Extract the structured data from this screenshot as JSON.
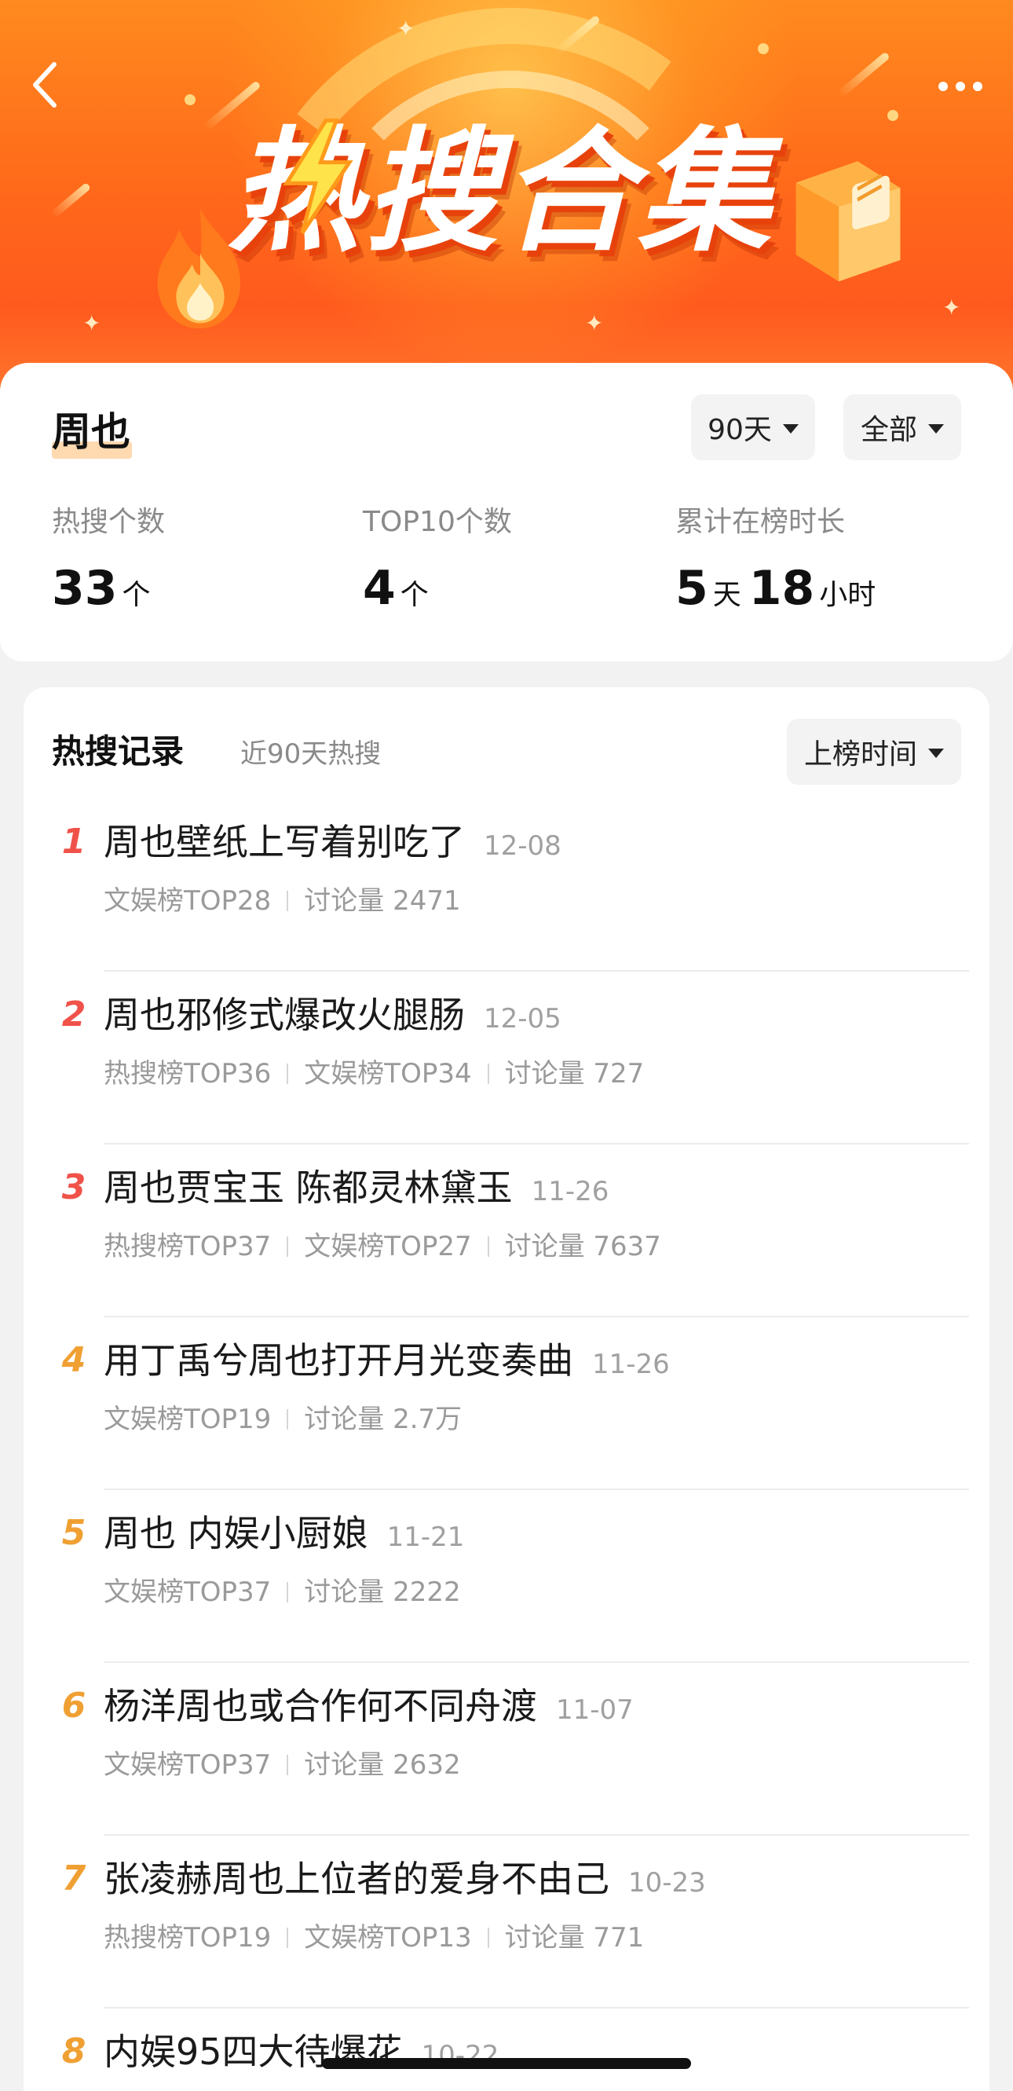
{
  "header": {
    "title": "热搜合集",
    "colors": {
      "banner_top": "#ff8a1f",
      "banner_bottom": "#ff5a1e",
      "title_shadow": "#e8420c"
    }
  },
  "summary": {
    "name": "周也",
    "filter_days": "90天",
    "filter_type": "全部",
    "stats": [
      {
        "label": "热搜个数",
        "value": "33",
        "unit": "个"
      },
      {
        "label": "TOP10个数",
        "value": "4",
        "unit": "个"
      },
      {
        "label": "累计在榜时长",
        "days": "5",
        "days_unit": "天",
        "hours": "18",
        "hours_unit": "小时"
      }
    ]
  },
  "records": {
    "title": "热搜记录",
    "subtitle": "近90天热搜",
    "sort_label": "上榜时间",
    "rank_colors": {
      "top3": "#f0524a",
      "rest": "#f0a033"
    },
    "items": [
      {
        "rank": "1",
        "title": "周也壁纸上写着别吃了",
        "date": "12-08",
        "tags": [
          "文娱榜TOP28",
          "讨论量 2471"
        ]
      },
      {
        "rank": "2",
        "title": "周也邪修式爆改火腿肠",
        "date": "12-05",
        "tags": [
          "热搜榜TOP36",
          "文娱榜TOP34",
          "讨论量 727"
        ]
      },
      {
        "rank": "3",
        "title": "周也贾宝玉 陈都灵林黛玉",
        "date": "11-26",
        "tags": [
          "热搜榜TOP37",
          "文娱榜TOP27",
          "讨论量 7637"
        ]
      },
      {
        "rank": "4",
        "title": "用丁禹兮周也打开月光变奏曲",
        "date": "11-26",
        "tags": [
          "文娱榜TOP19",
          "讨论量 2.7万"
        ]
      },
      {
        "rank": "5",
        "title": "周也 内娱小厨娘",
        "date": "11-21",
        "tags": [
          "文娱榜TOP37",
          "讨论量 2222"
        ]
      },
      {
        "rank": "6",
        "title": "杨洋周也或合作何不同舟渡",
        "date": "11-07",
        "tags": [
          "文娱榜TOP37",
          "讨论量 2632"
        ]
      },
      {
        "rank": "7",
        "title": "张凌赫周也上位者的爱身不由己",
        "date": "10-23",
        "tags": [
          "热搜榜TOP19",
          "文娱榜TOP13",
          "讨论量 771"
        ]
      },
      {
        "rank": "8",
        "title": "内娱95四大待爆花",
        "date": "10-22",
        "tags": []
      }
    ]
  }
}
